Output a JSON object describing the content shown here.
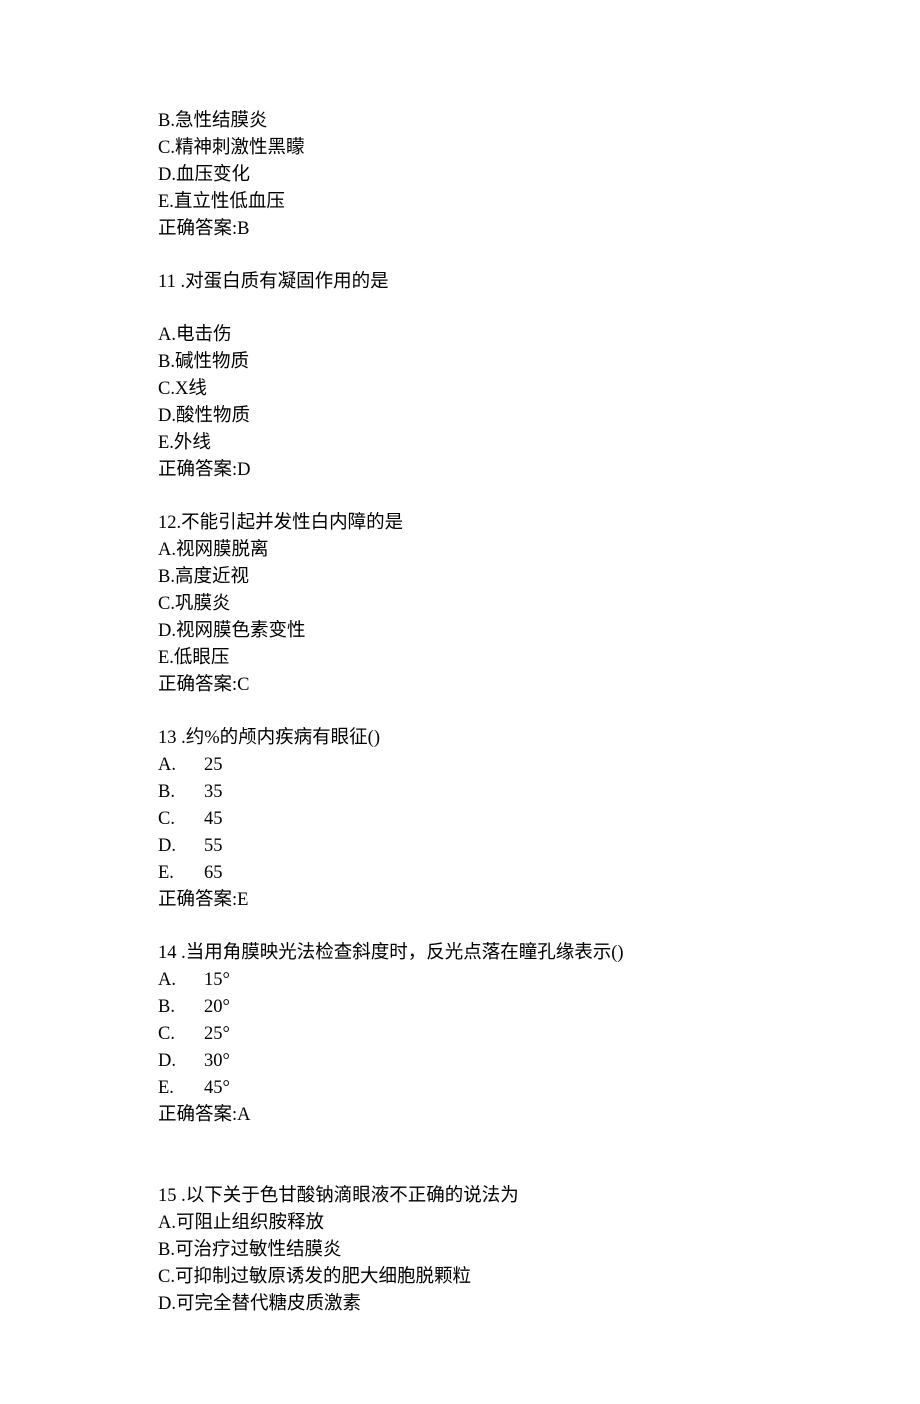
{
  "q10_continued": {
    "options": {
      "B": "B.急性结膜炎",
      "C": "C.精神刺激性黑矇",
      "D": "D.血压变化",
      "E": "E.直立性低血压"
    },
    "answer": "正确答案:B"
  },
  "q11": {
    "stem": "11 .对蛋白质有凝固作用的是",
    "options": {
      "A": "A.电击伤",
      "B": "B.碱性物质",
      "C": "C.X线",
      "D": "D.酸性物质",
      "E": "E.外线"
    },
    "answer": "正确答案:D"
  },
  "q12": {
    "stem": "12.不能引起并发性白内障的是",
    "options": {
      "A": "A.视网膜脱离",
      "B": "B.高度近视",
      "C": "C.巩膜炎",
      "D": "D.视网膜色素变性",
      "E": "E.低眼压"
    },
    "answer": "正确答案:C"
  },
  "q13": {
    "stem": "13 .约%的颅内疾病有眼征()",
    "options": {
      "A": {
        "letter": "A.",
        "value": "25"
      },
      "B": {
        "letter": "B.",
        "value": "35"
      },
      "C": {
        "letter": "C.",
        "value": "45"
      },
      "D": {
        "letter": "D.",
        "value": "55"
      },
      "E": {
        "letter": "E.",
        "value": "65"
      }
    },
    "answer": "正确答案:E"
  },
  "q14": {
    "stem": "14 .当用角膜映光法检查斜度时，反光点落在瞳孔缘表示()",
    "options": {
      "A": {
        "letter": "A.",
        "value": "15°"
      },
      "B": {
        "letter": "B.",
        "value": "20°"
      },
      "C": {
        "letter": "C.",
        "value": "25°"
      },
      "D": {
        "letter": "D.",
        "value": "30°"
      },
      "E": {
        "letter": "E.",
        "value": "45°"
      }
    },
    "answer": "正确答案:A"
  },
  "q15": {
    "stem": "15 .以下关于色甘酸钠滴眼液不正确的说法为",
    "options": {
      "A": "A.可阻止组织胺释放",
      "B": "B.可治疗过敏性结膜炎",
      "C": "C.可抑制过敏原诱发的肥大细胞脱颗粒",
      "D": "D.可完全替代糖皮质激素"
    }
  }
}
